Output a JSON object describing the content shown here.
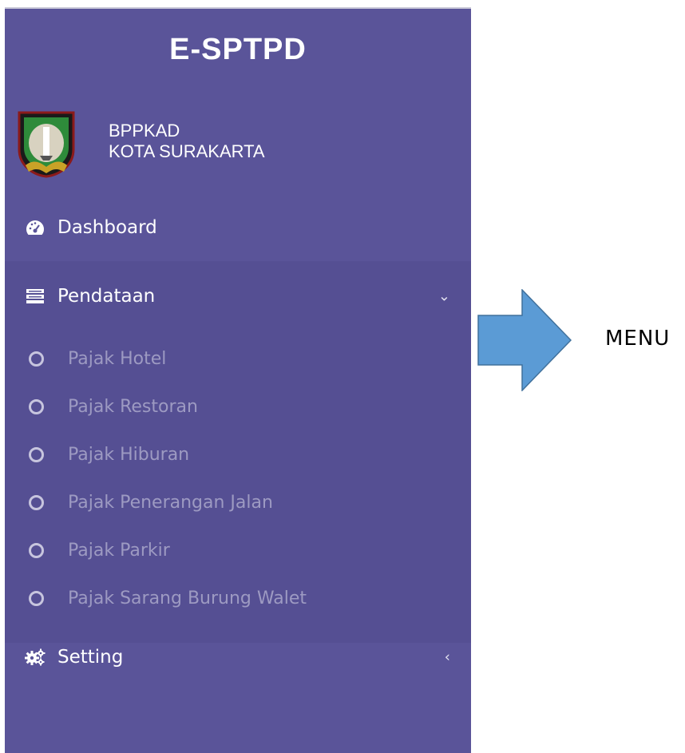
{
  "sidebar": {
    "brand": "E-SPTPD",
    "org_line1": "BPPKAD",
    "org_line2": "KOTA SURAKARTA",
    "menu": [
      {
        "label": "Dashboard",
        "icon": "dashboard-icon"
      },
      {
        "label": "Pendataan",
        "icon": "list-icon",
        "caret": "⌄"
      },
      {
        "label": "Setting",
        "icon": "gears-icon",
        "caret": "‹"
      }
    ],
    "submenu": [
      {
        "label": "Pajak Hotel"
      },
      {
        "label": "Pajak Restoran"
      },
      {
        "label": "Pajak Hiburan"
      },
      {
        "label": "Pajak Penerangan Jalan"
      },
      {
        "label": "Pajak Parkir"
      },
      {
        "label": "Pajak Sarang Burung Walet"
      }
    ]
  },
  "annotation": {
    "text": "MENU",
    "arrow_color": "#5b9bd5"
  },
  "colors": {
    "sidebar_bg": "#5a5499",
    "submenu_text": "#9d9ac2"
  }
}
